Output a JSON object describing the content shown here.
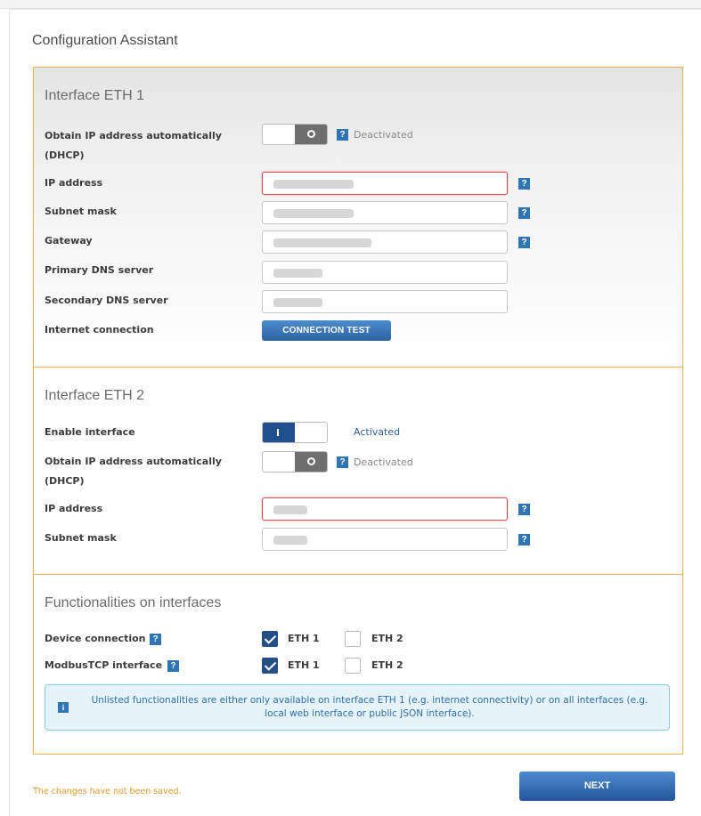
{
  "app": {
    "title": "Configuration Assistant"
  },
  "eth1": {
    "title": "Interface ETH 1",
    "dhcp_label": "Obtain IP address automatically (DHCP)",
    "dhcp_state": "Deactivated",
    "ip_label": "IP address",
    "subnet_label": "Subnet mask",
    "gateway_label": "Gateway",
    "dns1_label": "Primary DNS server",
    "dns2_label": "Secondary DNS server",
    "internet_label": "Internet connection",
    "test_button": "CONNECTION TEST"
  },
  "eth2": {
    "title": "Interface ETH 2",
    "enable_label": "Enable interface",
    "enable_state": "Activated",
    "dhcp_label": "Obtain IP address automatically (DHCP)",
    "dhcp_state": "Deactivated",
    "ip_label": "IP address",
    "subnet_label": "Subnet mask"
  },
  "functions": {
    "title": "Functionalities on interfaces",
    "rows": [
      {
        "label": "Device connection",
        "eth1": "ETH 1",
        "eth2": "ETH 2",
        "eth1_checked": true,
        "eth2_checked": false
      },
      {
        "label": "ModbusTCP interface",
        "eth1": "ETH 1",
        "eth2": "ETH 2",
        "eth1_checked": true,
        "eth2_checked": false
      }
    ],
    "info": "Unlisted functionalities are either only available on interface ETH 1 (e.g. internet connectivity) or on all interfaces (e.g. local web interface or public JSON interface)."
  },
  "footer": {
    "unsaved": "The changes have not been saved.",
    "next_button": "NEXT"
  },
  "icons": {
    "help": "?",
    "info": "i"
  },
  "colors": {
    "accent": "#f3b44a",
    "primary": "#2b62a2",
    "error": "#e6494b"
  }
}
